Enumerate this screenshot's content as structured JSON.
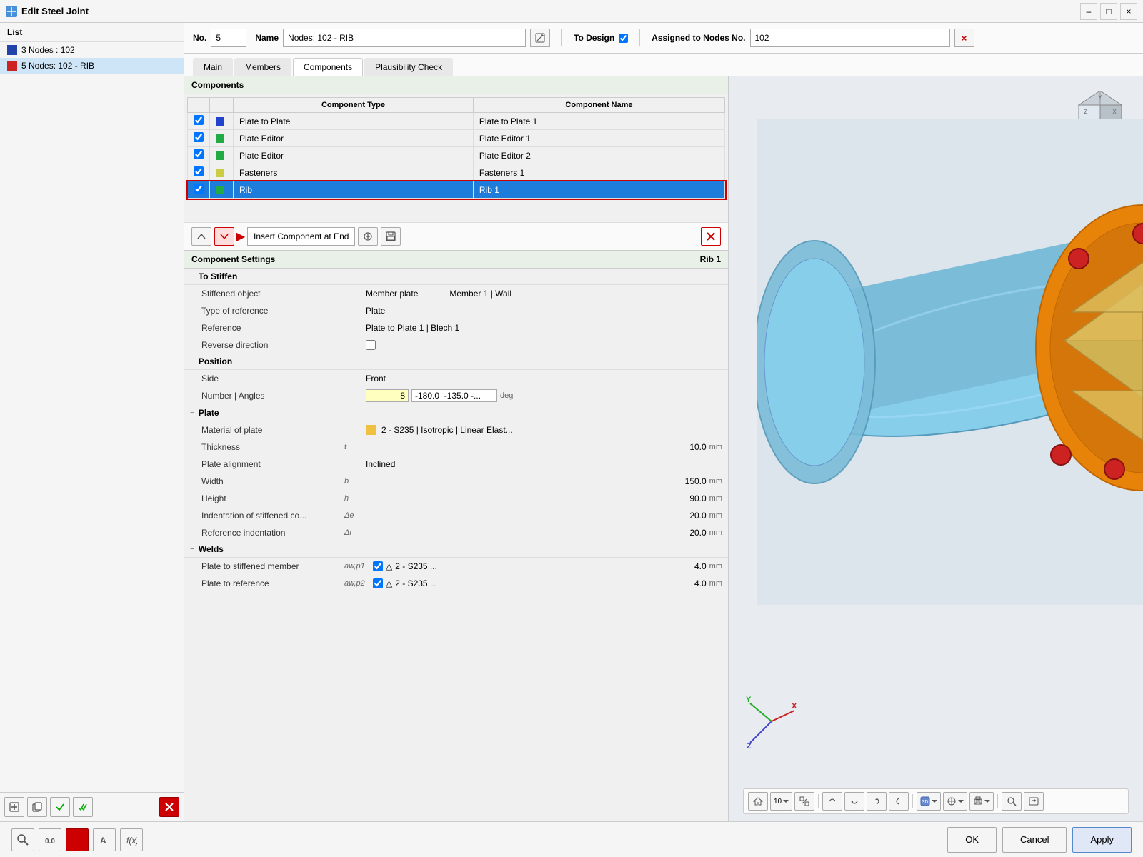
{
  "titleBar": {
    "icon": "steel-joint-icon",
    "title": "Edit Steel Joint",
    "minimizeLabel": "–",
    "maximizeLabel": "□",
    "closeLabel": "×"
  },
  "leftPanel": {
    "header": "List",
    "items": [
      {
        "label": "3 Nodes : 102",
        "color": "#2244aa",
        "selected": false
      },
      {
        "label": "5 Nodes: 102 - RIB",
        "color": "#cc2222",
        "selected": true
      }
    ],
    "bottomButtons": [
      "add-icon",
      "copy-icon",
      "check-icon",
      "check2-icon",
      "delete-icon"
    ]
  },
  "topFields": {
    "noLabel": "No.",
    "noValue": "5",
    "nameLabel": "Name",
    "nameValue": "Nodes: 102 - RIB",
    "toDesignLabel": "To Design",
    "toDesignChecked": true,
    "assignedLabel": "Assigned to Nodes No.",
    "assignedValue": "102"
  },
  "tabs": [
    {
      "label": "Main",
      "active": false
    },
    {
      "label": "Members",
      "active": false
    },
    {
      "label": "Components",
      "active": true
    },
    {
      "label": "Plausibility Check",
      "active": false
    }
  ],
  "components": {
    "sectionTitle": "Components",
    "tableHeaders": [
      "Component Type",
      "Component Name"
    ],
    "rows": [
      {
        "checked": true,
        "color": "#2244cc",
        "type": "Plate to Plate",
        "name": "Plate to Plate 1",
        "selected": false
      },
      {
        "checked": true,
        "color": "#22aa44",
        "type": "Plate Editor",
        "name": "Plate Editor 1",
        "selected": false
      },
      {
        "checked": true,
        "color": "#22aa44",
        "type": "Plate Editor",
        "name": "Plate Editor 2",
        "selected": false
      },
      {
        "checked": true,
        "color": "#cccc44",
        "type": "Fasteners",
        "name": "Fasteners 1",
        "selected": false
      },
      {
        "checked": true,
        "color": "#22aa44",
        "type": "Rib",
        "name": "Rib 1",
        "selected": true
      }
    ],
    "toolbar": {
      "moveUpLabel": "↑",
      "moveDownLabel": "↓",
      "insertLabel": "Insert Component at End",
      "importLabel": "⊕",
      "saveLabel": "💾",
      "deleteLabel": "×"
    }
  },
  "componentSettings": {
    "title": "Component Settings",
    "subtitle": "Rib 1",
    "groups": [
      {
        "name": "To Stiffen",
        "collapsed": false,
        "properties": [
          {
            "label": "Stiffened object",
            "symbol": "",
            "value": "Member plate",
            "extra": "Member 1 | Wall"
          },
          {
            "label": "Type of reference",
            "symbol": "",
            "value": "Plate",
            "extra": ""
          },
          {
            "label": "Reference",
            "symbol": "",
            "value": "Plate to Plate 1 | Blech 1",
            "extra": ""
          },
          {
            "label": "Reverse direction",
            "symbol": "",
            "value": "",
            "extra": "",
            "hasCheckbox": true
          }
        ]
      },
      {
        "name": "Position",
        "collapsed": false,
        "properties": [
          {
            "label": "Side",
            "symbol": "",
            "value": "Front",
            "extra": ""
          },
          {
            "label": "Number | Angles",
            "symbol": "",
            "valueNum": "8",
            "value": "-180.0  -135.0 -...",
            "unit": "deg"
          }
        ]
      },
      {
        "name": "Plate",
        "collapsed": false,
        "properties": [
          {
            "label": "Material of plate",
            "symbol": "",
            "value": "2 - S235 | Isotropic | Linear Elast...",
            "hasMaterialColor": true
          },
          {
            "label": "Thickness",
            "symbol": "t",
            "valueNum": "10.0",
            "unit": "mm"
          },
          {
            "label": "Plate alignment",
            "symbol": "",
            "value": "Inclined"
          },
          {
            "label": "Width",
            "symbol": "b",
            "valueNum": "150.0",
            "unit": "mm"
          },
          {
            "label": "Height",
            "symbol": "h",
            "valueNum": "90.0",
            "unit": "mm"
          },
          {
            "label": "Indentation of stiffened co...",
            "symbol": "Δe",
            "valueNum": "20.0",
            "unit": "mm"
          },
          {
            "label": "Reference indentation",
            "symbol": "Δr",
            "valueNum": "20.0",
            "unit": "mm"
          }
        ]
      },
      {
        "name": "Welds",
        "collapsed": false,
        "properties": [
          {
            "label": "Plate to stiffened member",
            "symbol": "aw,p1",
            "valueNum": "4.0",
            "unit": "mm",
            "hasWeld": true,
            "weldValue": "2 - S235 ..."
          },
          {
            "label": "Plate to reference",
            "symbol": "aw,p2",
            "valueNum": "4.0",
            "unit": "mm",
            "hasWeld": true,
            "weldValue": "2 - S235 ..."
          }
        ]
      }
    ]
  },
  "bottomBar": {
    "buttons": [
      "search-icon",
      "dimension-icon",
      "red-square-icon",
      "text-icon",
      "formula-icon"
    ],
    "okLabel": "OK",
    "cancelLabel": "Cancel",
    "applyLabel": "Apply"
  },
  "axes": {
    "x": "X",
    "y": "Y",
    "z": "Z"
  }
}
